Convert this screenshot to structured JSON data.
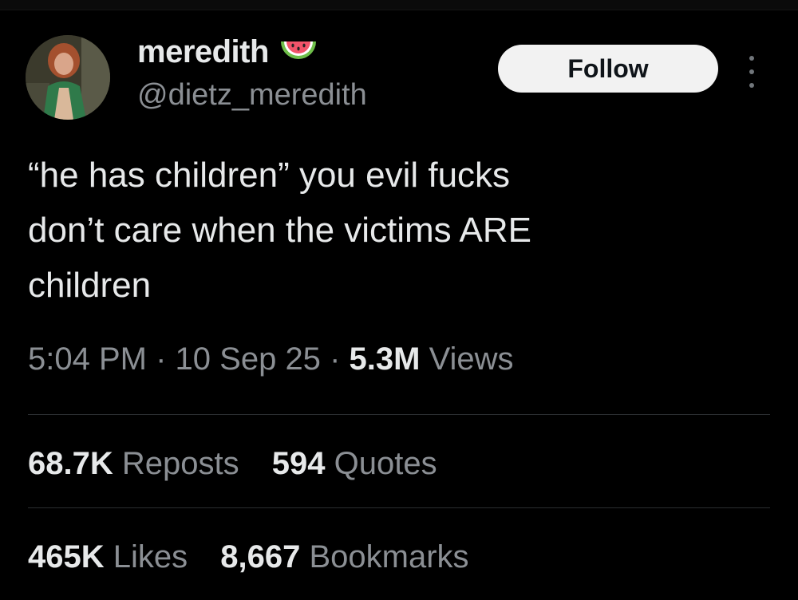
{
  "author": {
    "display_name": "meredith",
    "handle": "@dietz_meredith",
    "badge_icon": "watermelon-emoji",
    "avatar_icon": "profile-photo"
  },
  "actions": {
    "follow_label": "Follow",
    "more_icon": "vertical-ellipsis-icon"
  },
  "tweet": {
    "lines": [
      "“he has children” you evil fucks",
      "don’t care when the victims ARE",
      "children"
    ]
  },
  "meta": {
    "time": "5:04 PM",
    "separator": "·",
    "date": "10 Sep 25",
    "views_count": "5.3M",
    "views_label": "Views"
  },
  "engagement": {
    "reposts_count": "68.7K",
    "reposts_label": "Reposts",
    "quotes_count": "594",
    "quotes_label": "Quotes",
    "likes_count": "465K",
    "likes_label": "Likes",
    "bookmarks_count": "8,667",
    "bookmarks_label": "Bookmarks"
  },
  "colors": {
    "background": "#000000",
    "text_primary": "#e7e9ea",
    "text_secondary": "#8b8f94",
    "divider": "#2a2d30",
    "follow_bg": "#f2f2f2"
  }
}
